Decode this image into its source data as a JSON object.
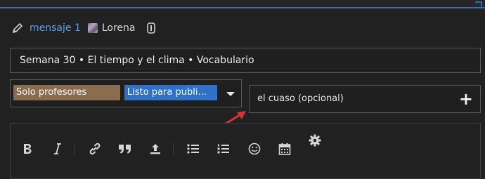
{
  "header": {
    "reply_label": "mensaje 1",
    "username": "Lorena",
    "icons": [
      "pencil-icon",
      "user-avatar",
      "history-icon"
    ]
  },
  "title": {
    "value": "Semana 30 • El tiempo y el clima • Vocabulario"
  },
  "tags": [
    {
      "label": "Solo profesores",
      "color": "#8a6d4f"
    },
    {
      "label": "Listo para publi...",
      "color": "#2f70c9"
    }
  ],
  "cc": {
    "placeholder": "el cuaso (opcional)"
  },
  "toolbar": {
    "items": [
      "bold",
      "italic",
      "link",
      "quote",
      "upload",
      "bullet-list",
      "numbered-list",
      "emoji",
      "calendar",
      "settings"
    ]
  },
  "colors": {
    "accent": "#5aa0e6",
    "arrow": "#d9303b",
    "background": "#212121"
  }
}
